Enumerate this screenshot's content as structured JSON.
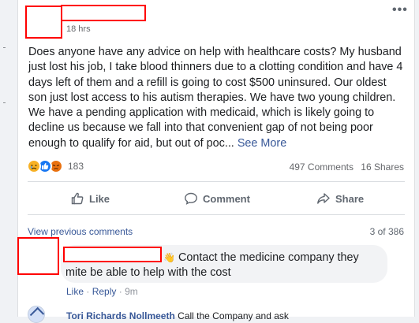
{
  "post": {
    "timestamp": "18 hrs",
    "more_icon": "•••",
    "text": "Does anyone have any advice on help with healthcare costs? My husband just lost his job, I take blood thinners due to a clotting condition and have 4 days left of them and a refill is going to cost $500 uninsured. Our oldest son just lost access to his autism therapies. We have two young children. We have a pending application with medicaid, which is likely going to decline us because we fall into that convenient gap of not being poor enough to qualify for aid, but out of poc...",
    "see_more": "See More"
  },
  "reactions": {
    "icons": [
      "sad-reaction-icon",
      "like-reaction-icon",
      "angry-reaction-icon"
    ],
    "count": "183",
    "comments": "497 Comments",
    "shares": "16 Shares"
  },
  "actions": {
    "like": "Like",
    "comment": "Comment",
    "share": "Share"
  },
  "comments_section": {
    "view_previous": "View previous comments",
    "pager": "3 of 386",
    "comment1": {
      "emoji": "👋",
      "text": "Contact the medicine company they mite be able to help with the cost",
      "like": "Like",
      "sep": "·",
      "reply": "Reply",
      "time": "9m"
    },
    "comment2": {
      "author": "Tori Richards Nollmeeth",
      "text": "Call the Company and ask"
    }
  },
  "colors": {
    "link": "#385898",
    "muted": "#65676b",
    "redaction": "#ff0000"
  }
}
